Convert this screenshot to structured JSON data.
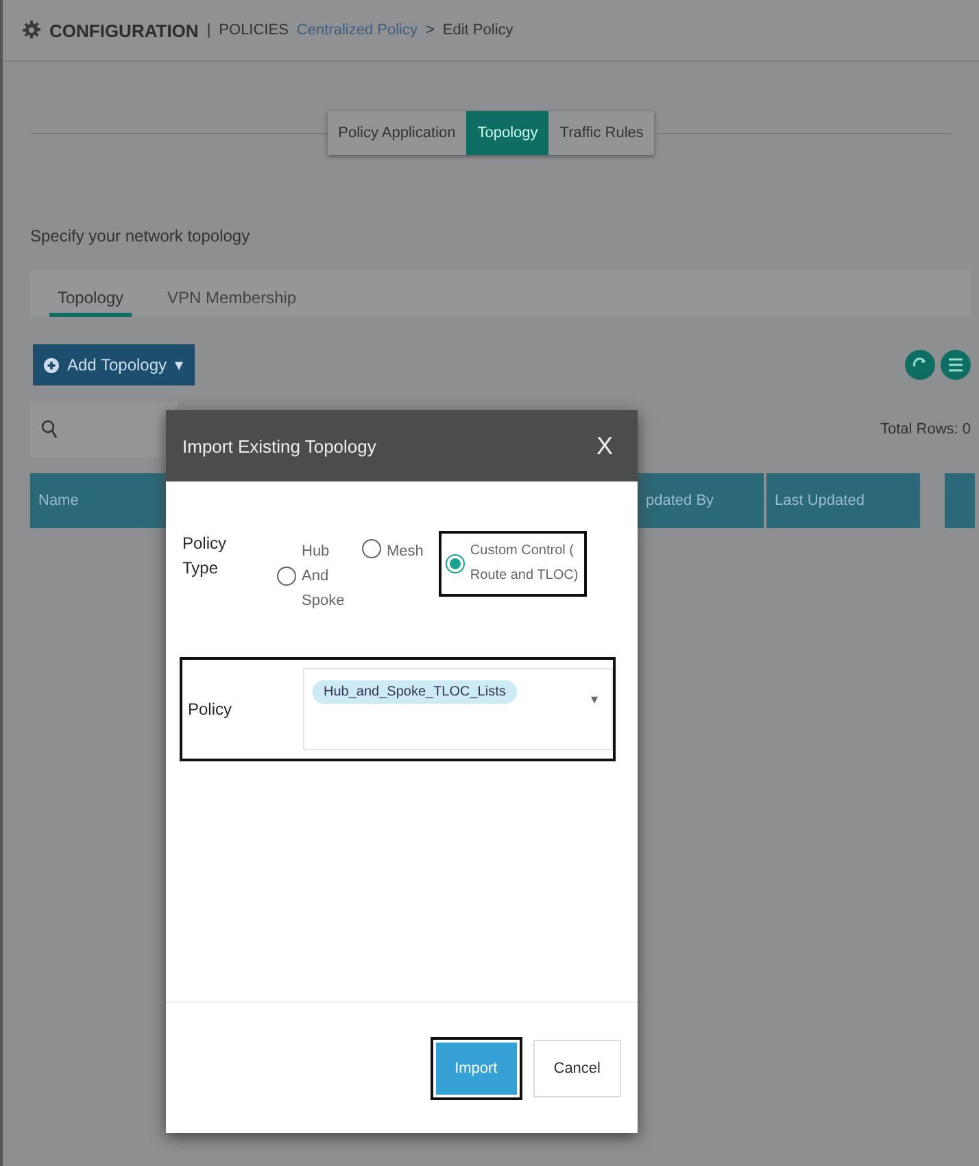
{
  "header": {
    "section": "CONFIGURATION",
    "separator": "|",
    "subsection": "POLICIES",
    "breadcrumb": [
      {
        "label": "Centralized Policy",
        "kind": "link"
      },
      {
        "label": "Edit Policy",
        "kind": "current"
      }
    ],
    "breadcrumb_separator": ">"
  },
  "steps": [
    {
      "label": "Policy Application",
      "selected": false
    },
    {
      "label": "Topology",
      "selected": true
    },
    {
      "label": "Traffic Rules",
      "selected": false
    }
  ],
  "prompt": "Specify your network topology",
  "subtabs": [
    {
      "label": "Topology",
      "selected": true
    },
    {
      "label": "VPN Membership",
      "selected": false
    }
  ],
  "add_button": {
    "label": "Add Topology",
    "caret": "▾"
  },
  "total_rows": "Total Rows: 0",
  "table": {
    "columns": [
      "Name",
      "pdated By",
      "Last Updated"
    ]
  },
  "dialog": {
    "title": "Import Existing Topology",
    "close": "X",
    "policy_type_label": "Policy Type",
    "options": [
      {
        "label": "Hub And Spoke",
        "selected": false,
        "highlighted": false
      },
      {
        "label": "Mesh",
        "selected": false,
        "highlighted": false
      },
      {
        "label": "Custom Control ( Route and TLOC)",
        "selected": true,
        "highlighted": true
      }
    ],
    "policy": {
      "label": "Policy",
      "value": "Hub_and_Spoke_TLOC_Lists",
      "caret": "▾",
      "highlighted": true
    },
    "buttons": [
      {
        "label": "Import",
        "kind": "primary",
        "highlighted": true
      },
      {
        "label": "Cancel",
        "kind": "secondary",
        "highlighted": false
      }
    ]
  }
}
